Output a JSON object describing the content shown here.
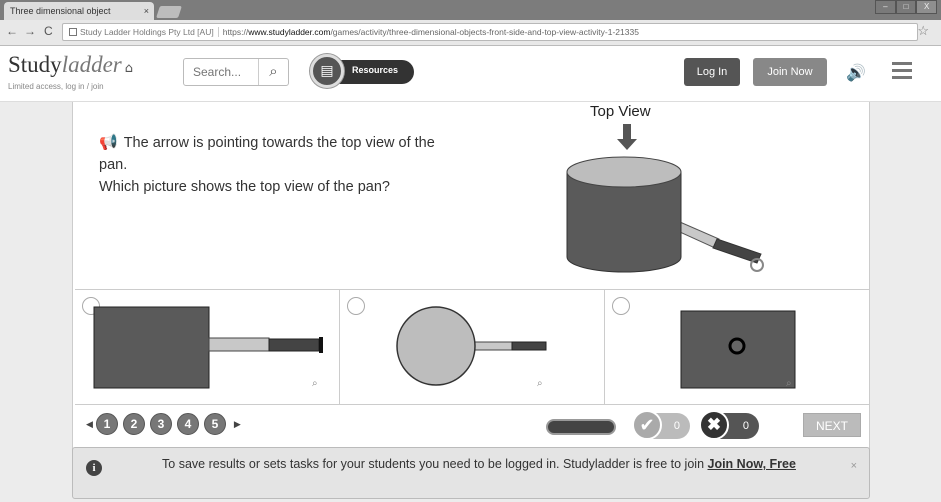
{
  "browser": {
    "tab_title": "Three dimensional object",
    "tab_close": "×",
    "window_controls": [
      "–",
      "□",
      "X"
    ],
    "url_owner": "Study Ladder Holdings Pty Ltd [AU]",
    "url_prefix": "https://",
    "url_host": "www.studyladder.com",
    "url_path": "/games/activity/three-dimensional-objects-front-side-and-top-view-activity-1-21335"
  },
  "header": {
    "logo_main": "Study",
    "logo_accent": "ladder",
    "sublogo": "Limited access, log in / join",
    "search_placeholder": "Search...",
    "resources_label": "Resources",
    "login_label": "Log In",
    "join_label": "Join Now"
  },
  "question": {
    "line1": "The arrow is pointing towards the top view of the pan.",
    "line2": "Which picture shows the top view of the pan?",
    "figure_label": "Top View"
  },
  "pager": {
    "pages": [
      "1",
      "2",
      "3",
      "4",
      "5"
    ]
  },
  "score": {
    "correct": "0",
    "wrong": "0",
    "next_label": "NEXT"
  },
  "notice": {
    "text": "To save results or sets tasks for your students you need to be logged in. Studyladder is free to join",
    "link": "Join Now, Free",
    "dismiss": "×"
  },
  "colors": {
    "pan_body": "#5a5a5a",
    "pan_top": "#bdbdbd",
    "handle_light": "#c8c8c8",
    "handle_dark": "#444444"
  }
}
